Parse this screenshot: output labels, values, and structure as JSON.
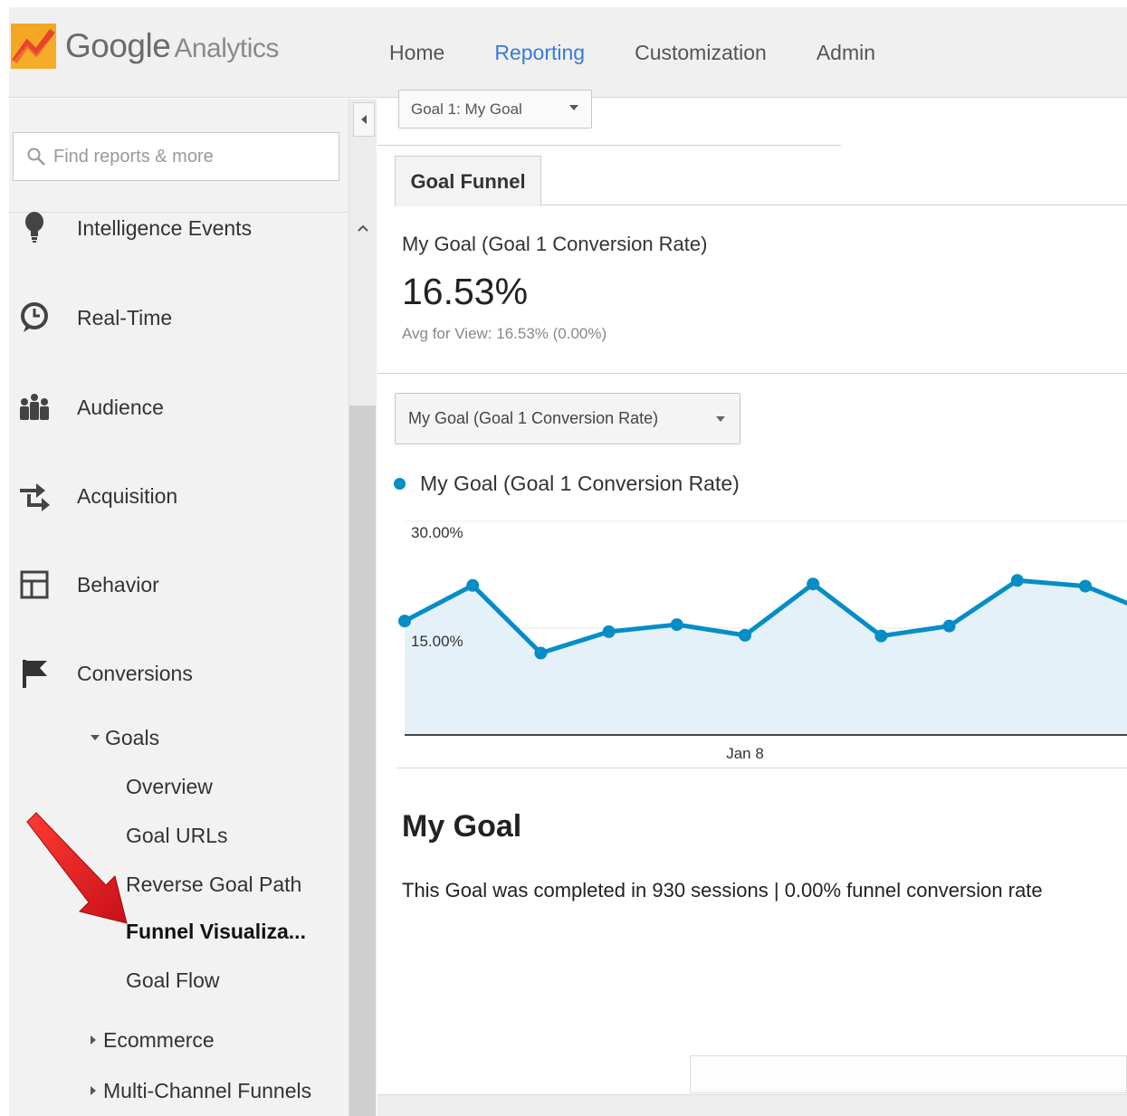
{
  "header": {
    "logo_brand": "Google",
    "logo_product": "Analytics",
    "nav": [
      {
        "label": "Home"
      },
      {
        "label": "Reporting"
      },
      {
        "label": "Customization"
      },
      {
        "label": "Admin"
      }
    ],
    "active_nav": "Reporting",
    "accent_color": "#3a7bd5"
  },
  "sidebar": {
    "search_placeholder": "Find reports & more",
    "items": [
      {
        "label": "Intelligence Events",
        "icon": "lightbulb-icon"
      },
      {
        "label": "Real-Time",
        "icon": "clock-icon"
      },
      {
        "label": "Audience",
        "icon": "people-icon"
      },
      {
        "label": "Acquisition",
        "icon": "arrows-icon"
      },
      {
        "label": "Behavior",
        "icon": "layout-icon"
      },
      {
        "label": "Conversions",
        "icon": "flag-icon"
      }
    ],
    "goals_label": "Goals",
    "goals_children": [
      "Overview",
      "Goal URLs",
      "Reverse Goal Path",
      "Funnel Visualiza...",
      "Goal Flow"
    ],
    "active_child": "Funnel Visualiza...",
    "ecommerce_label": "Ecommerce",
    "multichannel_label": "Multi-Channel Funnels"
  },
  "main": {
    "goal_selector": "Goal 1: My Goal",
    "tab_label": "Goal Funnel",
    "metric_title": "My Goal (Goal 1 Conversion Rate)",
    "metric_value": "16.53%",
    "metric_avg": "Avg for View: 16.53% (0.00%)",
    "metric_selector": "My Goal (Goal 1 Conversion Rate)",
    "goal_heading": "My Goal",
    "goal_summary": "This Goal was completed in 930 sessions | 0.00% funnel conversion rate"
  },
  "chart_data": {
    "type": "line",
    "series": [
      {
        "name": "My Goal (Goal 1 Conversion Rate)",
        "color": "#058dc7",
        "values": [
          16.0,
          21.0,
          11.5,
          14.5,
          15.5,
          14.0,
          21.2,
          13.9,
          15.3,
          21.7,
          20.9,
          17.0
        ]
      }
    ],
    "ylim": [
      0,
      30
    ],
    "y_ticks": [
      "30.00%",
      "15.00%"
    ],
    "x_tick_labels": [
      {
        "label": "Jan 8",
        "index": 5
      }
    ]
  }
}
